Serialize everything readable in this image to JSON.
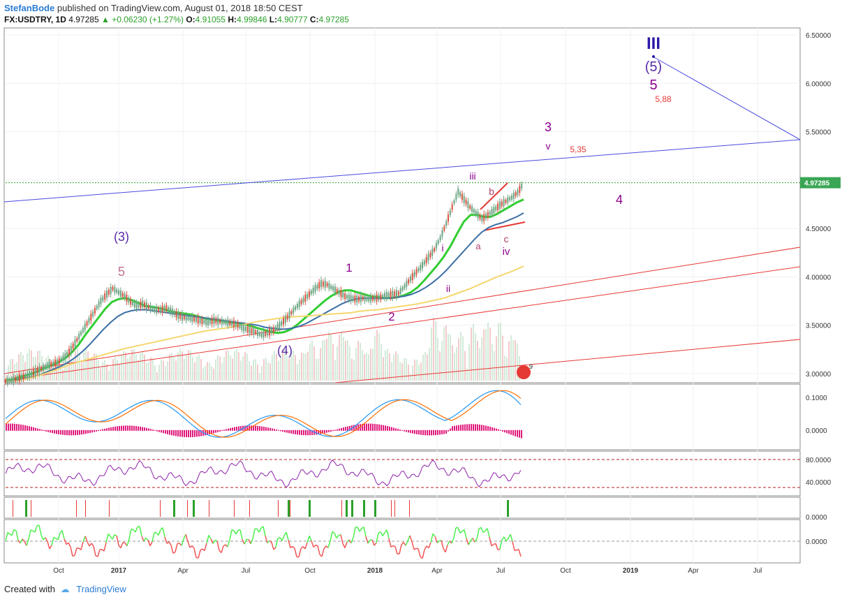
{
  "header": {
    "author": "StefanBode",
    "published": "published on TradingView.com, August 01, 2018 18:50 CEST",
    "symbol": "FX:USDTRY, 1D",
    "last": "4.97285",
    "change": "+0.06230 (+1.27%)",
    "o_label": "O:",
    "o_value": "4.91055",
    "h_label": "H:",
    "h_value": "4.99846",
    "l_label": "L:",
    "l_value": "4.90777",
    "c_label": "C:",
    "c_value": "4.97285"
  },
  "footer": {
    "created_with": "Created with",
    "brand": "TradingView"
  },
  "colors": {
    "candle_up": "#6ba583",
    "candle_down": "#d75442",
    "ema_fast": "#32cd32",
    "ema_slow": "#3a6ea5",
    "ma_long": "#f5d76e",
    "wave_purple": "#8b008b",
    "wave_navy": "#2b1aa8",
    "trend_red": "#e53935",
    "trend_blue": "#4a4ae0"
  },
  "chart_data": {
    "type": "line",
    "price_axis": {
      "ylim": [
        2.95,
        6.55
      ],
      "ticks": [
        "6.50000",
        "6.00000",
        "5.50000",
        "5.00000",
        "4.50000",
        "4.00000",
        "3.50000",
        "3.00000"
      ],
      "current_price_label": "4.97285"
    },
    "time_axis": {
      "ticks": [
        "Oct",
        "2017",
        "Apr",
        "Jul",
        "Oct",
        "2018",
        "Apr",
        "Jul",
        "Oct",
        "2019",
        "Apr",
        "Jul"
      ]
    },
    "series": [
      {
        "values_close": [
          2.92,
          2.93,
          2.95,
          2.97,
          2.99,
          3.02,
          3.05,
          3.08,
          3.1,
          3.13,
          3.18,
          3.25,
          3.35,
          3.45,
          3.55,
          3.65,
          3.75,
          3.82,
          3.88,
          3.84,
          3.8,
          3.74,
          3.7,
          3.72,
          3.69,
          3.66,
          3.66,
          3.68,
          3.64,
          3.6,
          3.58,
          3.57,
          3.56,
          3.54,
          3.53,
          3.55,
          3.54,
          3.53,
          3.52,
          3.5,
          3.47,
          3.45,
          3.43,
          3.4,
          3.42,
          3.45,
          3.5,
          3.56,
          3.63,
          3.7,
          3.76,
          3.82,
          3.88,
          3.93,
          3.92,
          3.88,
          3.84,
          3.8,
          3.78,
          3.77,
          3.78,
          3.77,
          3.78,
          3.79,
          3.81,
          3.82,
          3.83,
          3.9,
          3.98,
          4.05,
          4.12,
          4.2,
          4.28,
          4.4,
          4.55,
          4.72,
          4.88,
          4.8,
          4.72,
          4.66,
          4.6,
          4.64,
          4.69,
          4.74,
          4.78,
          4.82,
          4.87,
          4.97
        ]
      }
    ],
    "moving_averages": [
      {
        "values": [
          2.93,
          2.94,
          2.96,
          2.98,
          3.0,
          3.03,
          3.06,
          3.09,
          3.12,
          3.16,
          3.22,
          3.3,
          3.4,
          3.49,
          3.58,
          3.67,
          3.74,
          3.77,
          3.78,
          3.76,
          3.73,
          3.7,
          3.69,
          3.68,
          3.66,
          3.64,
          3.63,
          3.62,
          3.61,
          3.59,
          3.57,
          3.56,
          3.55,
          3.54,
          3.53,
          3.52,
          3.51,
          3.49,
          3.47,
          3.45,
          3.43,
          3.42,
          3.43,
          3.46,
          3.51,
          3.57,
          3.63,
          3.69,
          3.75,
          3.8,
          3.84,
          3.86,
          3.86,
          3.84,
          3.82,
          3.8,
          3.79,
          3.78,
          3.78,
          3.79,
          3.81,
          3.84,
          3.89,
          3.96,
          4.04,
          4.12,
          4.21,
          4.32,
          4.45,
          4.57,
          4.64,
          4.64,
          4.62,
          4.62,
          4.65,
          4.69,
          4.73,
          4.77,
          4.8
        ]
      },
      {
        "values": [
          2.92,
          2.93,
          2.94,
          2.95,
          2.97,
          2.99,
          3.02,
          3.05,
          3.08,
          3.12,
          3.17,
          3.23,
          3.3,
          3.38,
          3.46,
          3.53,
          3.59,
          3.63,
          3.65,
          3.66,
          3.66,
          3.65,
          3.64,
          3.63,
          3.62,
          3.61,
          3.6,
          3.59,
          3.58,
          3.57,
          3.56,
          3.55,
          3.54,
          3.53,
          3.52,
          3.51,
          3.5,
          3.48,
          3.47,
          3.46,
          3.46,
          3.47,
          3.49,
          3.52,
          3.56,
          3.6,
          3.64,
          3.68,
          3.72,
          3.75,
          3.77,
          3.78,
          3.78,
          3.78,
          3.78,
          3.78,
          3.79,
          3.8,
          3.82,
          3.85,
          3.89,
          3.94,
          4.0,
          4.07,
          4.15,
          4.23,
          4.31,
          4.39,
          4.46,
          4.51,
          4.54,
          4.56,
          4.59,
          4.62,
          4.66
        ]
      },
      {
        "values": [
          2.92,
          2.93,
          2.96,
          3.0,
          3.05,
          3.1,
          3.14,
          3.18,
          3.22,
          3.26,
          3.29,
          3.32,
          3.35,
          3.38,
          3.41,
          3.44,
          3.46,
          3.48,
          3.51,
          3.54,
          3.56,
          3.58,
          3.59,
          3.6,
          3.61,
          3.62,
          3.63,
          3.65,
          3.66,
          3.68,
          3.7,
          3.72,
          3.75,
          3.78,
          3.83,
          3.88,
          3.94,
          4.0,
          4.05,
          4.11
        ]
      }
    ],
    "wave_labels": [
      "(3)",
      "5",
      "(4)",
      "1",
      "2",
      "i",
      "ii",
      "iii",
      "a",
      "b",
      "c",
      "iv",
      "3",
      "v",
      "4",
      "5",
      "(5)",
      "III"
    ],
    "targets": [
      "5,35",
      "5,88"
    ],
    "macd": {
      "ticks": [
        "0.1000",
        "0.0000"
      ]
    },
    "rsi": {
      "ticks": [
        "80.0000",
        "40.0000"
      ],
      "upper": 80,
      "lower": 30
    },
    "signals": {
      "ticks": [
        "0.0000"
      ]
    },
    "momentum": {
      "ticks": [
        "0.0000"
      ]
    },
    "badge_count": "9"
  }
}
